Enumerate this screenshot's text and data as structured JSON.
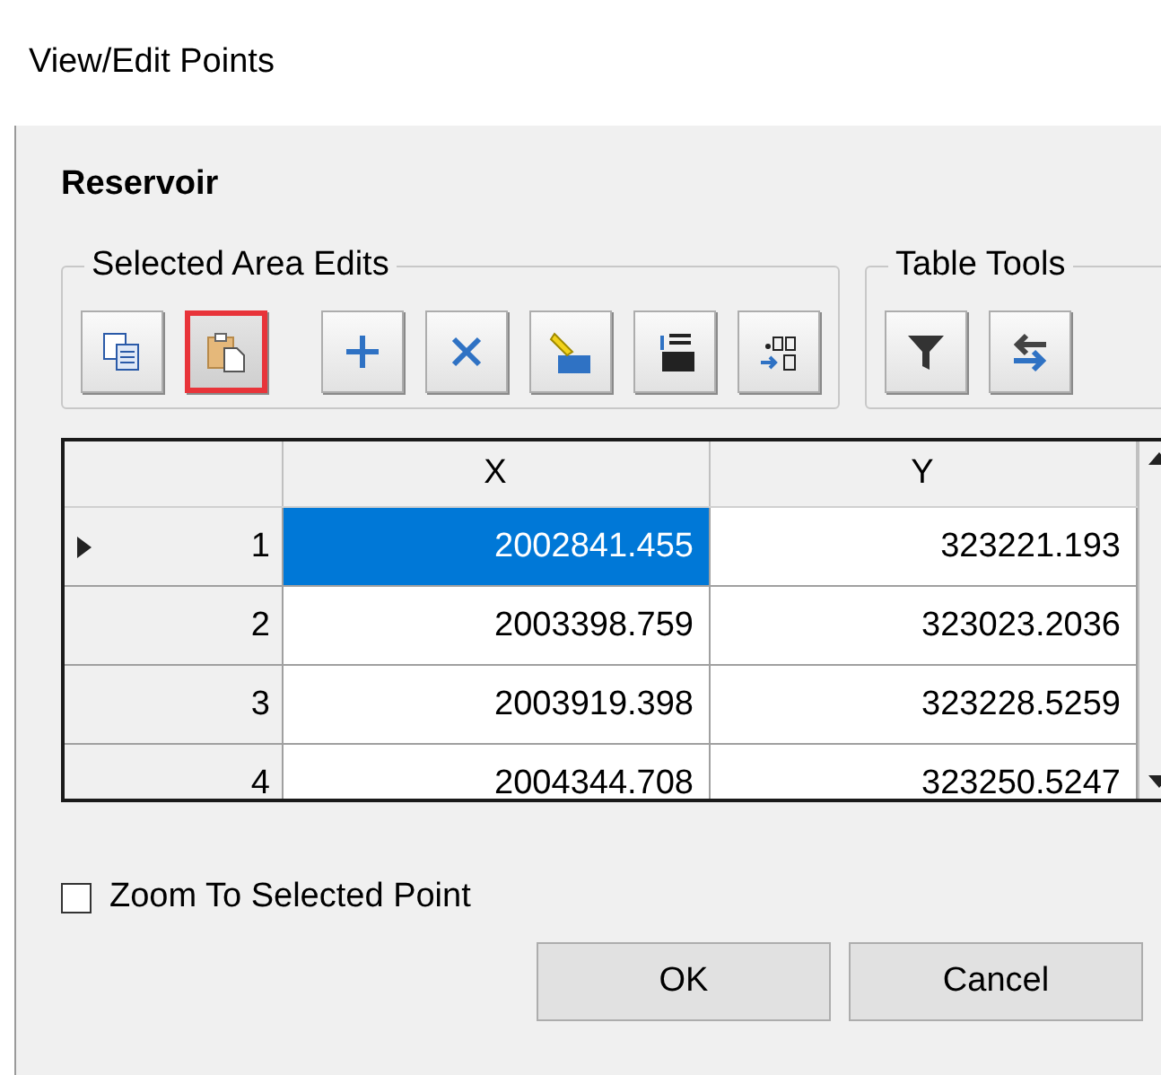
{
  "window": {
    "title": "View/Edit Points"
  },
  "layer_name": "Reservoir",
  "groups": [
    {
      "title": "Selected Area Edits",
      "tool_sets": [
        [
          {
            "kind": "copy",
            "highlighted": false
          },
          {
            "kind": "paste",
            "highlighted": true
          }
        ],
        [
          {
            "kind": "add",
            "highlighted": false
          },
          {
            "kind": "delete",
            "highlighted": false
          },
          {
            "kind": "renumber",
            "highlighted": false
          },
          {
            "kind": "sequence",
            "highlighted": false
          },
          {
            "kind": "decimals",
            "highlighted": false
          }
        ]
      ]
    },
    {
      "title": "Table Tools",
      "tool_sets": [
        [
          {
            "kind": "filter",
            "highlighted": false
          },
          {
            "kind": "swap",
            "highlighted": false
          }
        ]
      ]
    }
  ],
  "table": {
    "columns": [
      "X",
      "Y"
    ],
    "rows": [
      {
        "index": "1",
        "selected": true,
        "cells": [
          "2002841.455",
          "323221.193"
        ]
      },
      {
        "index": "2",
        "selected": false,
        "cells": [
          "2003398.759",
          "323023.2036"
        ]
      },
      {
        "index": "3",
        "selected": false,
        "cells": [
          "2003919.398",
          "323228.5259"
        ]
      },
      {
        "index": "4",
        "selected": false,
        "cells": [
          "2004344.708",
          "323250.5247"
        ]
      }
    ]
  },
  "zoom_checkbox": {
    "label": "Zoom To Selected Point",
    "checked": false
  },
  "buttons": [
    "OK",
    "Cancel"
  ]
}
